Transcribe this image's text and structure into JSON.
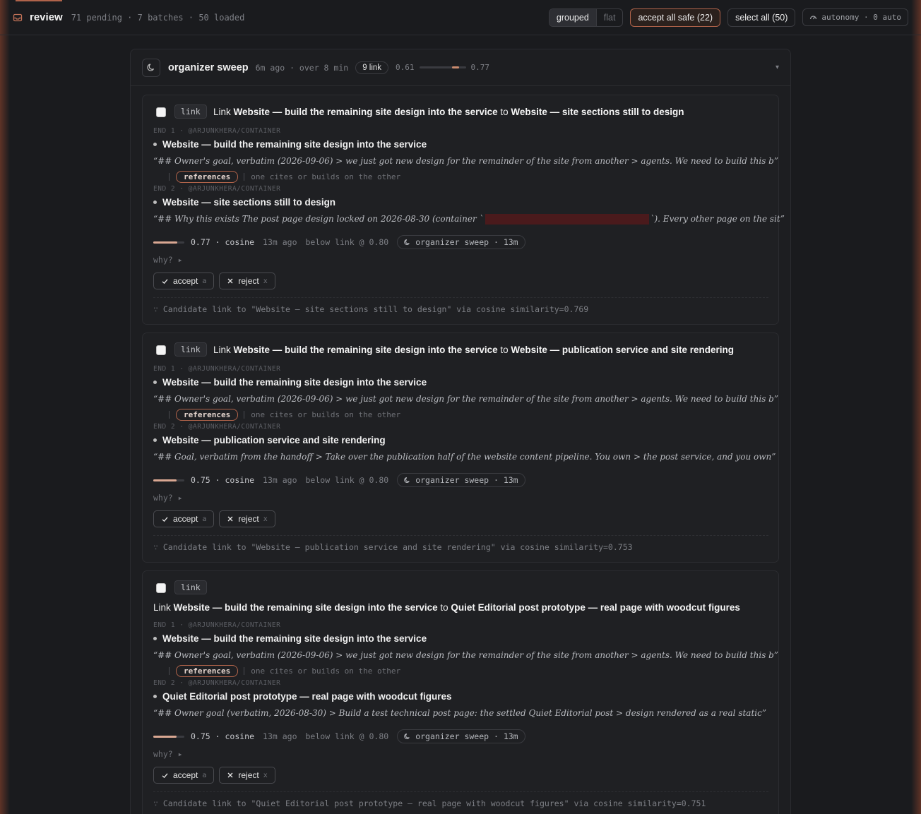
{
  "topbar": {
    "title": "review",
    "meta": "71 pending · 7 batches · 50 loaded",
    "view_grouped": "grouped",
    "view_flat": "flat",
    "accept_all": "accept all safe (22)",
    "select_all": "select all (50)",
    "autonomy": "autonomy · 0 auto"
  },
  "batch": {
    "title": "organizer sweep",
    "meta": "6m ago · over 8 min",
    "count": "9 link",
    "range_lo": "0.61",
    "range_hi": "0.77",
    "range_fraction": [
      0.7,
      0.85
    ]
  },
  "labels": {
    "kind": "link",
    "link_word": "Link",
    "to_word": "to",
    "end1": "END 1 · @ARJUNKHERA/CONTAINER",
    "end2": "END 2 · @ARJUNKHERA/CONTAINER",
    "relation": "references",
    "relation_note": "one cites or builds on the other",
    "why": "why? ▸",
    "accept": "accept",
    "accept_key": "a",
    "reject": "reject",
    "reject_key": "x",
    "method": "cosine",
    "age": "13m ago",
    "threshold": "below link @ 0.80",
    "source": "organizer sweep · 13m"
  },
  "cards": [
    {
      "from_title": "Website — build the remaining site design into the service",
      "to_title": "Website — site sections still to design",
      "end1_quote": "“## Owner's goal, verbatim (2026-09-06) > we just got new design for the remainder of the site from another > agents. We need to build this b”",
      "end2_quote_pre": "“## Why this exists The post page design locked on 2026-08-30 (container `",
      "end2_quote_post": "`). Every other page on the sit”",
      "score": "0.77",
      "score_value": 0.77,
      "reason": "Candidate link to \"Website — site sections still to design\" via cosine similarity=0.769"
    },
    {
      "from_title": "Website — build the remaining site design into the service",
      "to_title": "Website — publication service and site rendering",
      "end1_quote": "“## Owner's goal, verbatim (2026-09-06) > we just got new design for the remainder of the site from another > agents. We need to build this b”",
      "end2_quote": "“## Goal, verbatim from the handoff > Take over the publication half of the website content pipeline. You own > the post service, and you own”",
      "score": "0.75",
      "score_value": 0.75,
      "reason": "Candidate link to \"Website — publication service and site rendering\" via cosine similarity=0.753"
    },
    {
      "from_title": "Website — build the remaining site design into the service",
      "to_title": "Quiet Editorial post prototype — real page with woodcut figures",
      "end1_quote": "“## Owner's goal, verbatim (2026-09-06) > we just got new design for the remainder of the site from another > agents. We need to build this b”",
      "end2_quote": "“## Owner goal (verbatim, 2026-08-30) > Build a test technical post page: the settled Quiet Editorial post > design rendered as a real static”",
      "score": "0.75",
      "score_value": 0.75,
      "reason": "Candidate link to \"Quiet Editorial post prototype — real page with woodcut figures\" via cosine similarity=0.751"
    }
  ],
  "colors": {
    "accent": "#b0634a",
    "background": "#1a1b1e",
    "redaction": "#4a1a1c"
  }
}
